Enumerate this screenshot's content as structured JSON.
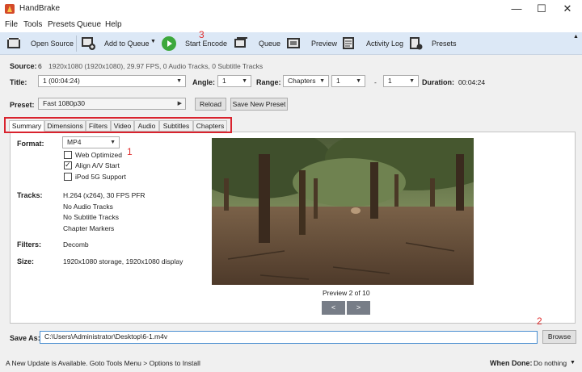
{
  "window": {
    "title": "HandBrake",
    "minimize": "—",
    "maximize": "☐",
    "close": "✕"
  },
  "menu": [
    "File",
    "Tools",
    "Presets",
    "Queue",
    "Help"
  ],
  "toolbar": {
    "open_source": "Open Source",
    "add_to_queue": "Add to Queue",
    "start_encode": "Start Encode",
    "queue": "Queue",
    "preview": "Preview",
    "activity_log": "Activity Log",
    "presets": "Presets"
  },
  "source": {
    "label": "Source:",
    "number": "6",
    "info": "1920x1080 (1920x1080), 29.97 FPS, 0 Audio Tracks, 0 Subtitle Tracks"
  },
  "title_row": {
    "title_label": "Title:",
    "title_value": "1 (00:04:24)",
    "angle_label": "Angle:",
    "angle_value": "1",
    "range_label": "Range:",
    "range_mode": "Chapters",
    "range_start": "1",
    "range_sep": "-",
    "range_end": "1",
    "duration_label": "Duration:",
    "duration_value": "00:04:24"
  },
  "preset": {
    "label": "Preset:",
    "value": "Fast 1080p30",
    "reload": "Reload",
    "save_new": "Save New Preset"
  },
  "tabs": [
    "Summary",
    "Dimensions",
    "Filters",
    "Video",
    "Audio",
    "Subtitles",
    "Chapters"
  ],
  "summary": {
    "format_label": "Format:",
    "format_value": "MP4",
    "web_optimized": "Web Optimized",
    "align_av": "Align A/V Start",
    "ipod": "iPod 5G Support",
    "tracks_label": "Tracks:",
    "tracks": [
      "H.264 (x264), 30 FPS PFR",
      "No Audio Tracks",
      "No Subtitle Tracks",
      "Chapter Markers"
    ],
    "filters_label": "Filters:",
    "filters_value": "Decomb",
    "size_label": "Size:",
    "size_value": "1920x1080 storage, 1920x1080 display",
    "preview_caption": "Preview 2 of 10",
    "prev": "<",
    "next": ">"
  },
  "annotations": {
    "one": "1",
    "two": "2",
    "three": "3"
  },
  "save_as": {
    "label": "Save As:",
    "path": "C:\\Users\\Administrator\\Desktop\\6-1.m4v",
    "browse": "Browse"
  },
  "status": {
    "update": "A New Update is Available. Goto Tools Menu > Options to Install",
    "when_done_label": "When Done:",
    "when_done_value": "Do nothing"
  },
  "colors": {
    "accent_red": "#d9232e",
    "toolbar_bg": "#dce8f6",
    "start_green": "#3ca83c"
  }
}
